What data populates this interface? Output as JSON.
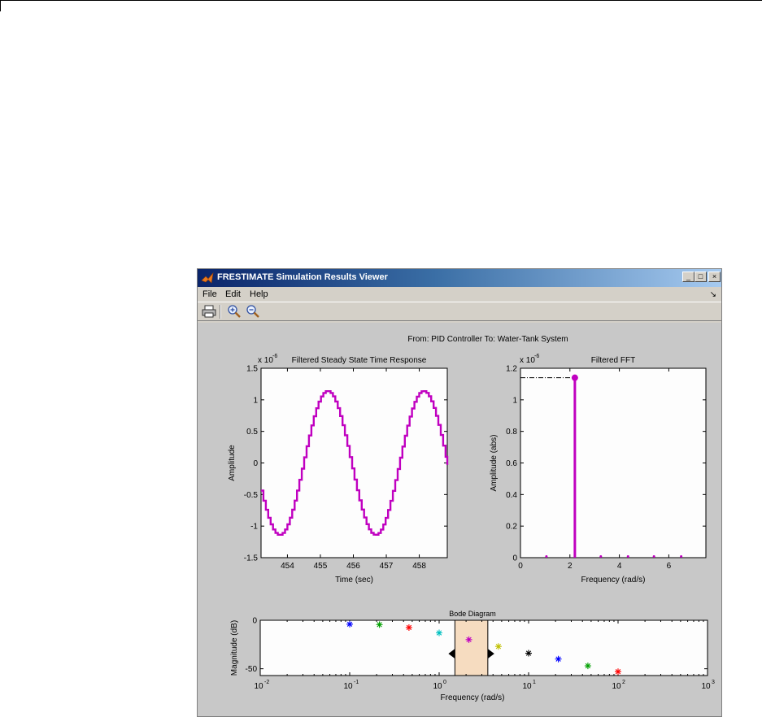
{
  "window": {
    "title": "FRESTIMATE Simulation Results Viewer",
    "controls": [
      "_",
      "□",
      "×"
    ]
  },
  "menu": {
    "items": [
      "File",
      "Edit",
      "Help"
    ],
    "corner_glyph": "↘"
  },
  "toolbar": {
    "icons": [
      "print-icon",
      "zoom-in-icon",
      "zoom-out-icon"
    ]
  },
  "figure": {
    "supertitle": "From: PID Controller  To: Water-Tank System"
  },
  "colors": {
    "series_magenta": "#c000c0",
    "axes_background": "#fdfdfd",
    "figure_background": "#c8c8c8",
    "highlight_band": "#f6dcc0"
  },
  "chart_data": [
    {
      "type": "line",
      "title": "Filtered Steady State Time Response",
      "xlabel": "Time (sec)",
      "ylabel": "Amplitude",
      "exponent_label": "x 10",
      "exponent_power": "-6",
      "xlim": [
        453.2,
        458.85
      ],
      "ylim": [
        -1.5,
        1.5
      ],
      "xticks": [
        454,
        455,
        456,
        457,
        458
      ],
      "yticks": [
        -1.5,
        -1,
        -0.5,
        0,
        0.5,
        1,
        1.5
      ],
      "series": [
        {
          "style": "staircase sinusoid",
          "amplitude": 1.14,
          "period": 2.91,
          "peak_at": 455.2
        }
      ]
    },
    {
      "type": "stem",
      "title": "Filtered FFT",
      "xlabel": "Frequency (rad/s)",
      "ylabel": "Amplitude (abs)",
      "exponent_label": "x 10",
      "exponent_power": "-6",
      "xlim": [
        0,
        7.5
      ],
      "ylim": [
        0,
        1.2
      ],
      "xticks": [
        0,
        2,
        4,
        6
      ],
      "yticks": [
        0,
        0.2,
        0.4,
        0.6,
        0.8,
        1,
        1.2
      ],
      "stems": [
        {
          "x": 1.05,
          "y": 0.01
        },
        {
          "x": 2.2,
          "y": 1.14
        },
        {
          "x": 3.25,
          "y": 0.004
        },
        {
          "x": 4.35,
          "y": 0.003
        },
        {
          "x": 5.4,
          "y": 0.002
        },
        {
          "x": 6.5,
          "y": 0.002
        }
      ],
      "reference_level": 1.14
    },
    {
      "type": "scatter",
      "title": "Bode Diagram",
      "xlabel": "Frequency  (rad/s)",
      "ylabel": "Magnitude (dB)",
      "xscale": "log",
      "xlim": [
        0.01,
        1000
      ],
      "ylim": [
        -57,
        0
      ],
      "xticks_base": "10",
      "xticks_exp": [
        "-2",
        "-1",
        "0",
        "1",
        "2",
        "3"
      ],
      "yticks": [
        0,
        -50
      ],
      "highlight_range": [
        1.5,
        3.5
      ],
      "points": [
        {
          "x": 0.1,
          "y": -4,
          "color": "#0000ff"
        },
        {
          "x": 0.215,
          "y": -4.5,
          "color": "#00a000"
        },
        {
          "x": 0.46,
          "y": -7.5,
          "color": "#ff0000"
        },
        {
          "x": 1.0,
          "y": -13,
          "color": "#00c0c0"
        },
        {
          "x": 2.15,
          "y": -20,
          "color": "#c000c0"
        },
        {
          "x": 4.6,
          "y": -27,
          "color": "#c0c000"
        },
        {
          "x": 10,
          "y": -34,
          "color": "#000000"
        },
        {
          "x": 21.5,
          "y": -40,
          "color": "#0000ff"
        },
        {
          "x": 46,
          "y": -47,
          "color": "#00a000"
        },
        {
          "x": 100,
          "y": -53,
          "color": "#ff0000"
        }
      ]
    }
  ]
}
